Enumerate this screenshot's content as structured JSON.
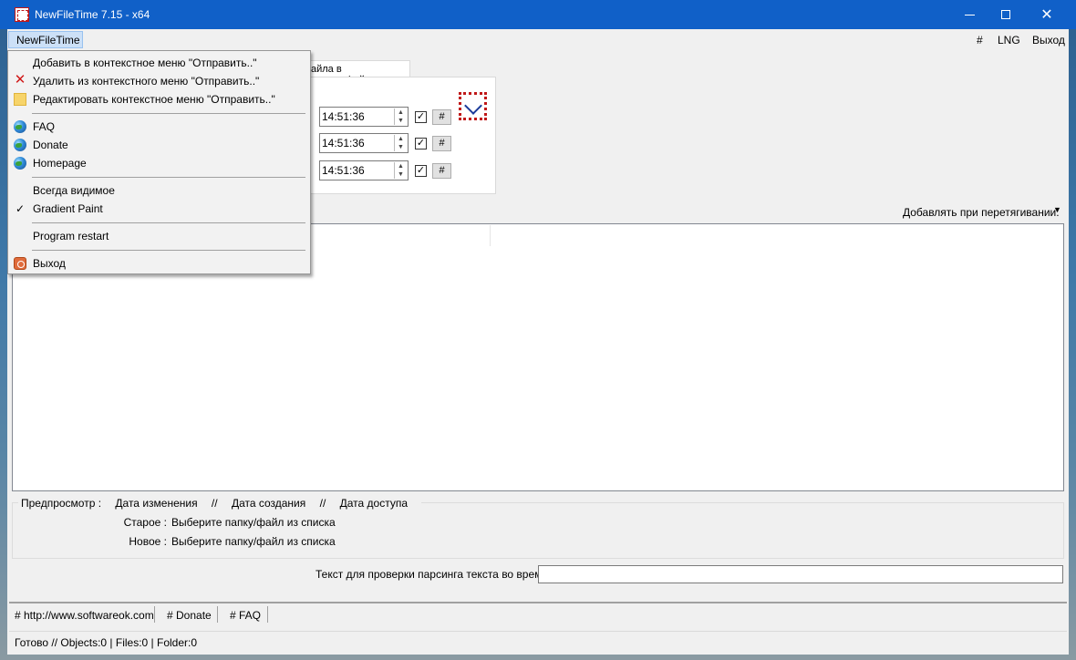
{
  "window": {
    "title": "NewFileTime 7.15 - x64"
  },
  "menubar": {
    "app_menu": "NewFileTime",
    "hash": "#",
    "lng": "LNG",
    "exit": "Выход"
  },
  "tab": {
    "label": "айла в время_файла"
  },
  "time_rows": [
    {
      "time": "14:51:36",
      "checked": true,
      "button": "#"
    },
    {
      "time": "14:51:36",
      "checked": true,
      "button": "#"
    },
    {
      "time": "14:51:36",
      "checked": true,
      "button": "#"
    }
  ],
  "drag_add": {
    "label": "Добавлять при перетягивании:"
  },
  "preview": {
    "header": [
      "Предпросмотр :",
      "Дата изменения",
      "//",
      "Дата создания",
      "//",
      "Дата доступа"
    ],
    "old_label": "Старое :",
    "old_value": "Выберите папку/файл из списка",
    "new_label": "Новое :",
    "new_value": "Выберите папку/файл из списка"
  },
  "parse": {
    "label": "Текст для проверки парсинга текста во время",
    "value": ""
  },
  "links": [
    "# http://www.softwareok.com",
    "# Donate",
    "# FAQ"
  ],
  "status": {
    "text": "Готово // Objects:0 | Files:0 | Folder:0"
  },
  "dropdown": {
    "items": [
      {
        "label": "Добавить в контекстное меню \"Отправить..\"",
        "icon": ""
      },
      {
        "label": "Удалить из контекстного меню \"Отправить..\"",
        "icon": "x-icon"
      },
      {
        "label": "Редактировать контекстное меню \"Отправить..\"",
        "icon": "folder-icon"
      },
      {
        "label": "FAQ",
        "icon": "globe-icon"
      },
      {
        "label": "Donate",
        "icon": "globe-icon"
      },
      {
        "label": "Homepage",
        "icon": "globe-icon"
      },
      {
        "label": "Всегда видимое",
        "icon": ""
      },
      {
        "label": "Gradient Paint",
        "icon": "check-icon"
      },
      {
        "label": "Program restart",
        "icon": ""
      },
      {
        "label": "Выход",
        "icon": "power-icon"
      }
    ]
  },
  "colors": {
    "titlebar": "#1060c8",
    "menu_highlight": "#cce0f7",
    "window_bg": "#f0f0f0"
  }
}
